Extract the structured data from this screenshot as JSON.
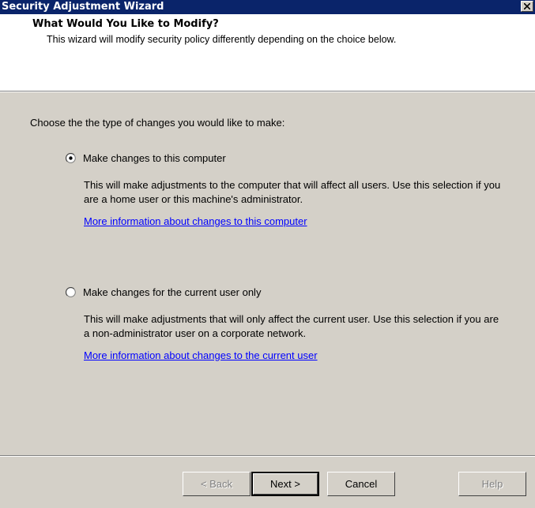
{
  "window": {
    "title": "Security Adjustment Wizard"
  },
  "header": {
    "title": "What Would You Like to Modify?",
    "description": "This wizard will modify security policy differently depending on the choice below."
  },
  "prompt": "Choose the the type of changes you would like to make:",
  "options": [
    {
      "label": "Make changes to this computer",
      "selected": true,
      "description": "This will make adjustments to the computer that will affect all users.  Use this selection if you are a home user or this machine's administrator.",
      "link": "More information about changes to this computer"
    },
    {
      "label": "Make changes for the current user only",
      "selected": false,
      "description": "This will make adjustments that will only affect the current user.  Use this selection if you are a non-administrator user on a corporate network.",
      "link": "More information about changes to the current user"
    }
  ],
  "buttons": {
    "back": "< Back",
    "next": "Next >",
    "cancel": "Cancel",
    "help": "Help"
  },
  "colors": {
    "titlebar": "#0a246a",
    "dialog_bg": "#d4d0c8",
    "link": "#0000ff"
  }
}
